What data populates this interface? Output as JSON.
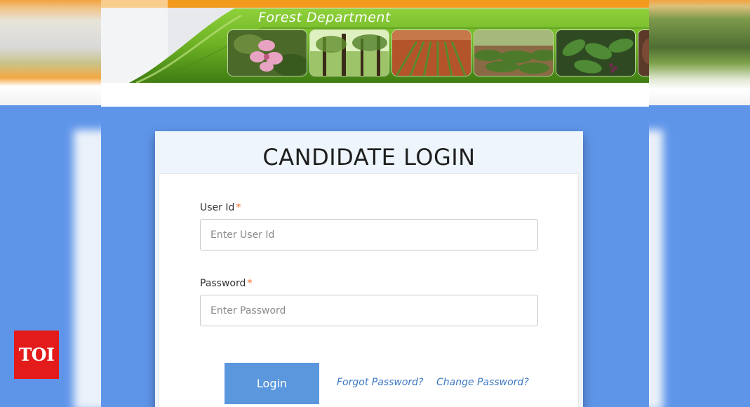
{
  "banner": {
    "title": "Forest Department",
    "photos": [
      "flower-photo",
      "forest-photo",
      "plantation-photo",
      "nursery-photo",
      "plant-photo"
    ]
  },
  "login": {
    "title": "CANDIDATE LOGIN",
    "user_id": {
      "label": "User Id",
      "required_mark": "*",
      "placeholder": "Enter User Id",
      "value": ""
    },
    "password": {
      "label": "Password",
      "required_mark": "*",
      "placeholder": "Enter Password",
      "value": ""
    },
    "login_button": "Login",
    "forgot_password_link": "Forgot Password?",
    "change_password_link": "Change Password?"
  },
  "watermark": {
    "text": "TOI"
  },
  "colors": {
    "background": "#5f95e9",
    "banner_orange": "#f29a1c",
    "banner_green": "#7cbf2a",
    "button": "#5b97dd",
    "link": "#3b78c2",
    "required": "#f26a21",
    "watermark": "#e31b1b"
  }
}
